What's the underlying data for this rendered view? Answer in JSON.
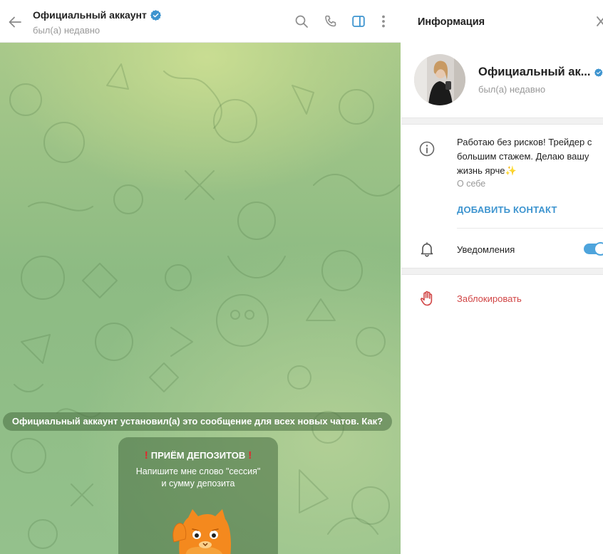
{
  "chat": {
    "title": "Официальный аккаунт",
    "status": "был(а) недавно",
    "pinned_notice": "Официальный аккаунт установил(а) это сообщение для всех новых чатов. Как?",
    "intro": {
      "heading": "ПРИЁМ ДЕПОЗИТОВ",
      "line1": "Напишите мне слово \"сессия\"",
      "line2": "и сумму депозита"
    }
  },
  "info_panel": {
    "title": "Информация",
    "name": "Официальный ак...",
    "status": "был(а) недавно",
    "bio_line1": "Работаю без рисков! Трейдер с",
    "bio_line2": "большим стажем. Делаю вашу",
    "bio_line3": "жизнь ярче",
    "bio_emoji": "✨",
    "bio_label": "О себе",
    "add_contact": "ДОБАВИТЬ КОНТАКТ",
    "notifications": "Уведомления",
    "notifications_on": true,
    "block": "Заблокировать"
  },
  "icons": {
    "back": "arrow-left-icon",
    "verified": "verified-badge-icon",
    "search": "search-icon",
    "call": "phone-icon",
    "sidebar": "sidebar-toggle-icon",
    "more": "more-vertical-icon",
    "close": "close-icon",
    "info": "info-icon",
    "bell": "bell-icon",
    "hand": "hand-stop-icon",
    "sticker": "orange-cat-sticker"
  },
  "colors": {
    "accent": "#3d94cf",
    "toggle": "#4ea4dc",
    "danger": "#d14545",
    "chat_bg": "#9ac388"
  }
}
